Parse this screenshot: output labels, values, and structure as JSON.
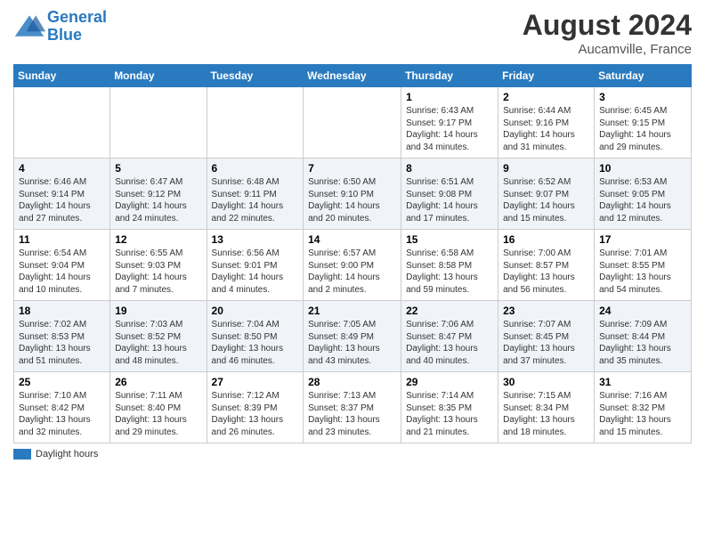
{
  "header": {
    "logo_line1": "General",
    "logo_line2": "Blue",
    "month_year": "August 2024",
    "location": "Aucamville, France"
  },
  "days_of_week": [
    "Sunday",
    "Monday",
    "Tuesday",
    "Wednesday",
    "Thursday",
    "Friday",
    "Saturday"
  ],
  "weeks": [
    [
      {
        "day": "",
        "info": ""
      },
      {
        "day": "",
        "info": ""
      },
      {
        "day": "",
        "info": ""
      },
      {
        "day": "",
        "info": ""
      },
      {
        "day": "1",
        "info": "Sunrise: 6:43 AM\nSunset: 9:17 PM\nDaylight: 14 hours\nand 34 minutes."
      },
      {
        "day": "2",
        "info": "Sunrise: 6:44 AM\nSunset: 9:16 PM\nDaylight: 14 hours\nand 31 minutes."
      },
      {
        "day": "3",
        "info": "Sunrise: 6:45 AM\nSunset: 9:15 PM\nDaylight: 14 hours\nand 29 minutes."
      }
    ],
    [
      {
        "day": "4",
        "info": "Sunrise: 6:46 AM\nSunset: 9:14 PM\nDaylight: 14 hours\nand 27 minutes."
      },
      {
        "day": "5",
        "info": "Sunrise: 6:47 AM\nSunset: 9:12 PM\nDaylight: 14 hours\nand 24 minutes."
      },
      {
        "day": "6",
        "info": "Sunrise: 6:48 AM\nSunset: 9:11 PM\nDaylight: 14 hours\nand 22 minutes."
      },
      {
        "day": "7",
        "info": "Sunrise: 6:50 AM\nSunset: 9:10 PM\nDaylight: 14 hours\nand 20 minutes."
      },
      {
        "day": "8",
        "info": "Sunrise: 6:51 AM\nSunset: 9:08 PM\nDaylight: 14 hours\nand 17 minutes."
      },
      {
        "day": "9",
        "info": "Sunrise: 6:52 AM\nSunset: 9:07 PM\nDaylight: 14 hours\nand 15 minutes."
      },
      {
        "day": "10",
        "info": "Sunrise: 6:53 AM\nSunset: 9:05 PM\nDaylight: 14 hours\nand 12 minutes."
      }
    ],
    [
      {
        "day": "11",
        "info": "Sunrise: 6:54 AM\nSunset: 9:04 PM\nDaylight: 14 hours\nand 10 minutes."
      },
      {
        "day": "12",
        "info": "Sunrise: 6:55 AM\nSunset: 9:03 PM\nDaylight: 14 hours\nand 7 minutes."
      },
      {
        "day": "13",
        "info": "Sunrise: 6:56 AM\nSunset: 9:01 PM\nDaylight: 14 hours\nand 4 minutes."
      },
      {
        "day": "14",
        "info": "Sunrise: 6:57 AM\nSunset: 9:00 PM\nDaylight: 14 hours\nand 2 minutes."
      },
      {
        "day": "15",
        "info": "Sunrise: 6:58 AM\nSunset: 8:58 PM\nDaylight: 13 hours\nand 59 minutes."
      },
      {
        "day": "16",
        "info": "Sunrise: 7:00 AM\nSunset: 8:57 PM\nDaylight: 13 hours\nand 56 minutes."
      },
      {
        "day": "17",
        "info": "Sunrise: 7:01 AM\nSunset: 8:55 PM\nDaylight: 13 hours\nand 54 minutes."
      }
    ],
    [
      {
        "day": "18",
        "info": "Sunrise: 7:02 AM\nSunset: 8:53 PM\nDaylight: 13 hours\nand 51 minutes."
      },
      {
        "day": "19",
        "info": "Sunrise: 7:03 AM\nSunset: 8:52 PM\nDaylight: 13 hours\nand 48 minutes."
      },
      {
        "day": "20",
        "info": "Sunrise: 7:04 AM\nSunset: 8:50 PM\nDaylight: 13 hours\nand 46 minutes."
      },
      {
        "day": "21",
        "info": "Sunrise: 7:05 AM\nSunset: 8:49 PM\nDaylight: 13 hours\nand 43 minutes."
      },
      {
        "day": "22",
        "info": "Sunrise: 7:06 AM\nSunset: 8:47 PM\nDaylight: 13 hours\nand 40 minutes."
      },
      {
        "day": "23",
        "info": "Sunrise: 7:07 AM\nSunset: 8:45 PM\nDaylight: 13 hours\nand 37 minutes."
      },
      {
        "day": "24",
        "info": "Sunrise: 7:09 AM\nSunset: 8:44 PM\nDaylight: 13 hours\nand 35 minutes."
      }
    ],
    [
      {
        "day": "25",
        "info": "Sunrise: 7:10 AM\nSunset: 8:42 PM\nDaylight: 13 hours\nand 32 minutes."
      },
      {
        "day": "26",
        "info": "Sunrise: 7:11 AM\nSunset: 8:40 PM\nDaylight: 13 hours\nand 29 minutes."
      },
      {
        "day": "27",
        "info": "Sunrise: 7:12 AM\nSunset: 8:39 PM\nDaylight: 13 hours\nand 26 minutes."
      },
      {
        "day": "28",
        "info": "Sunrise: 7:13 AM\nSunset: 8:37 PM\nDaylight: 13 hours\nand 23 minutes."
      },
      {
        "day": "29",
        "info": "Sunrise: 7:14 AM\nSunset: 8:35 PM\nDaylight: 13 hours\nand 21 minutes."
      },
      {
        "day": "30",
        "info": "Sunrise: 7:15 AM\nSunset: 8:34 PM\nDaylight: 13 hours\nand 18 minutes."
      },
      {
        "day": "31",
        "info": "Sunrise: 7:16 AM\nSunset: 8:32 PM\nDaylight: 13 hours\nand 15 minutes."
      }
    ]
  ],
  "legend": {
    "label": "Daylight hours"
  }
}
